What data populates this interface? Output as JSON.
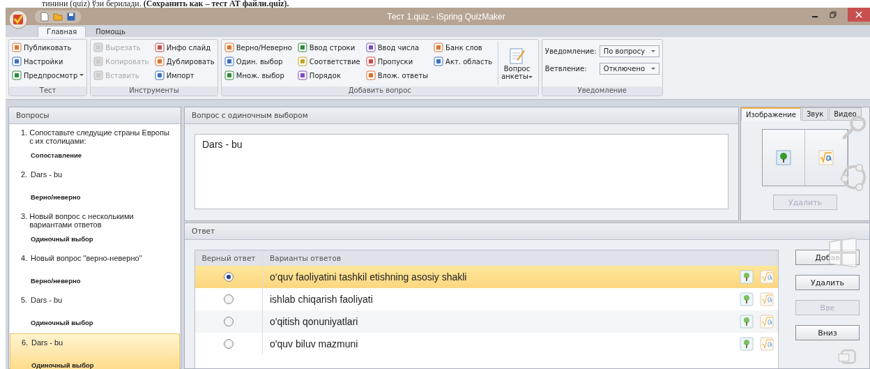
{
  "doc_text": "тинини (quiz) ўзи берилади. **(Сохранить как – тест АТ файли.quiz).**",
  "window": {
    "title": "Тест 1.quiz - iSpring QuizMaker"
  },
  "ribbon_tabs": [
    {
      "label": "Главная",
      "selected": true
    },
    {
      "label": "Помощь",
      "selected": false
    }
  ],
  "ribbon_groups": [
    {
      "label": "Тест",
      "columns": [
        [
          {
            "label": "Публиковать",
            "disabled": false,
            "dropdown": false
          },
          {
            "label": "Настройки",
            "disabled": false,
            "dropdown": false
          },
          {
            "label": "Предпросмотр",
            "disabled": false,
            "dropdown": true
          }
        ]
      ]
    },
    {
      "label": "Инструменты",
      "columns": [
        [
          {
            "label": "Вырезать",
            "disabled": true,
            "dropdown": false
          },
          {
            "label": "Копировать",
            "disabled": true,
            "dropdown": false
          },
          {
            "label": "Вставить",
            "disabled": true,
            "dropdown": false
          }
        ],
        [
          {
            "label": "Инфо слайд",
            "disabled": false,
            "dropdown": false
          },
          {
            "label": "Дублировать",
            "disabled": false,
            "dropdown": false
          },
          {
            "label": "Импорт",
            "disabled": false,
            "dropdown": false
          }
        ]
      ]
    },
    {
      "label": "Добавить вопрос",
      "columns": [
        [
          {
            "label": "Верно/Неверно",
            "disabled": false,
            "dropdown": false
          },
          {
            "label": "Один. выбор",
            "disabled": false,
            "dropdown": false
          },
          {
            "label": "Множ. выбор",
            "disabled": false,
            "dropdown": false
          }
        ],
        [
          {
            "label": "Ввод строки",
            "disabled": false,
            "dropdown": false
          },
          {
            "label": "Соответствие",
            "disabled": false,
            "dropdown": false
          },
          {
            "label": "Порядок",
            "disabled": false,
            "dropdown": false
          }
        ],
        [
          {
            "label": "Ввод числа",
            "disabled": false,
            "dropdown": false
          },
          {
            "label": "Пропуски",
            "disabled": false,
            "dropdown": false
          },
          {
            "label": "Влож. ответы",
            "disabled": false,
            "dropdown": false
          }
        ],
        [
          {
            "label": "Банк слов",
            "disabled": false,
            "dropdown": false
          },
          {
            "label": "Акт. область",
            "disabled": false,
            "dropdown": false
          }
        ]
      ],
      "large_button": {
        "label_lines": [
          "Вопрос",
          "анкеты"
        ],
        "dropdown": true
      }
    },
    {
      "label": "Уведомление",
      "fields": [
        {
          "label": "Уведомление:",
          "value": "По вопросу"
        },
        {
          "label": "Ветвление:",
          "value": "Отключено"
        }
      ]
    }
  ],
  "questions_panel": {
    "title": "Вопросы",
    "items": [
      {
        "number": "1.",
        "text": "Сопоставьте следущие страны Европы с их столицами:",
        "type": "Сопоставление",
        "selected": false
      },
      {
        "number": "2.",
        "text": "Dars - bu",
        "type": "Верно/неверно",
        "selected": false
      },
      {
        "number": "3.",
        "text": "Новый вопрос с несколькими вариантами ответов",
        "type": "Одиночный выбор",
        "selected": false
      },
      {
        "number": "4.",
        "text": "Новый вопрос \"верно-неверно\"",
        "type": "Верно/неверно",
        "selected": false
      },
      {
        "number": "5.",
        "text": "Dars - bu",
        "type": "Одиночный выбор",
        "selected": false
      },
      {
        "number": "6.",
        "text": "Dars - bu",
        "type": "Одиночный выбор",
        "selected": true
      }
    ]
  },
  "question_panel": {
    "title": "Вопрос с одиночным выбором",
    "text": "Dars - bu"
  },
  "media_panel": {
    "tabs": [
      {
        "label": "Изображение",
        "selected": true
      },
      {
        "label": "Звук",
        "selected": false
      },
      {
        "label": "Видео",
        "selected": false
      }
    ],
    "delete_button": {
      "label": "Удалить",
      "disabled": true
    }
  },
  "answer_panel": {
    "title": "Ответ",
    "columns": [
      "Верный ответ",
      "Варианты ответов"
    ],
    "rows": [
      {
        "text": "o‘quv faoliyatini tashkil etishning asosiy shakli",
        "correct": true,
        "selected": true
      },
      {
        "text": "ishlab chiqarish faoliyati",
        "correct": false,
        "selected": false
      },
      {
        "text": "o'qitish qonuniyatlari",
        "correct": false,
        "selected": false
      },
      {
        "text": "o'quv biluv mazmuni",
        "correct": false,
        "selected": false
      }
    ],
    "buttons": [
      {
        "label": "Добав",
        "disabled": false
      },
      {
        "label": "Удалить",
        "disabled": false
      },
      {
        "label": "Вве",
        "disabled": true
      },
      {
        "label": "Вниз",
        "disabled": false
      }
    ]
  }
}
